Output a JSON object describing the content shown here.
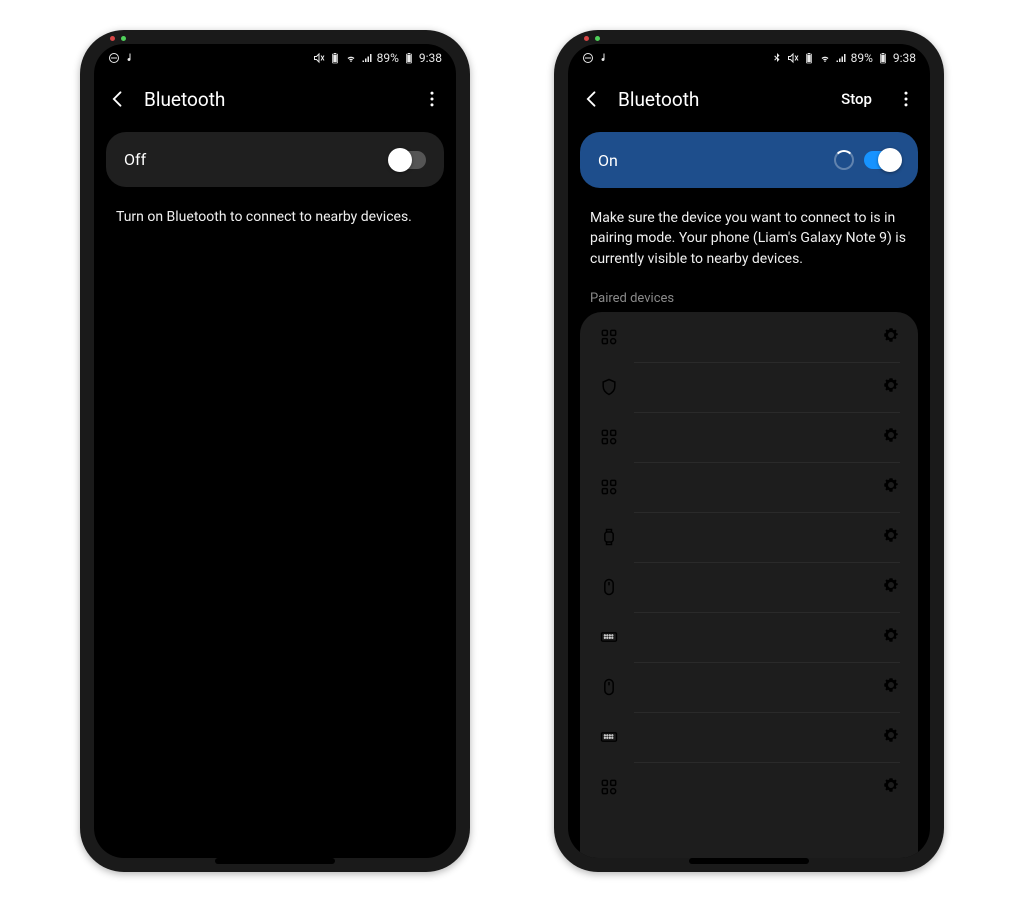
{
  "status": {
    "battery_text": "89%",
    "time": "9:38"
  },
  "left_phone": {
    "title": "Bluetooth",
    "toggle_label": "Off",
    "toggle_state": "off",
    "body": "Turn on Bluetooth to connect to nearby devices."
  },
  "right_phone": {
    "title": "Bluetooth",
    "stop_label": "Stop",
    "toggle_label": "On",
    "toggle_state": "on",
    "body": "Make sure the device you want to connect to is in pairing mode. Your phone (Liam's Galaxy Note 9) is currently visible to nearby devices.",
    "section_label": "Paired devices",
    "devices": [
      {
        "icon": "grid"
      },
      {
        "icon": "shield"
      },
      {
        "icon": "grid"
      },
      {
        "icon": "grid"
      },
      {
        "icon": "watch"
      },
      {
        "icon": "mouse"
      },
      {
        "icon": "keyboard"
      },
      {
        "icon": "mouse"
      },
      {
        "icon": "keyboard"
      },
      {
        "icon": "grid"
      }
    ]
  }
}
